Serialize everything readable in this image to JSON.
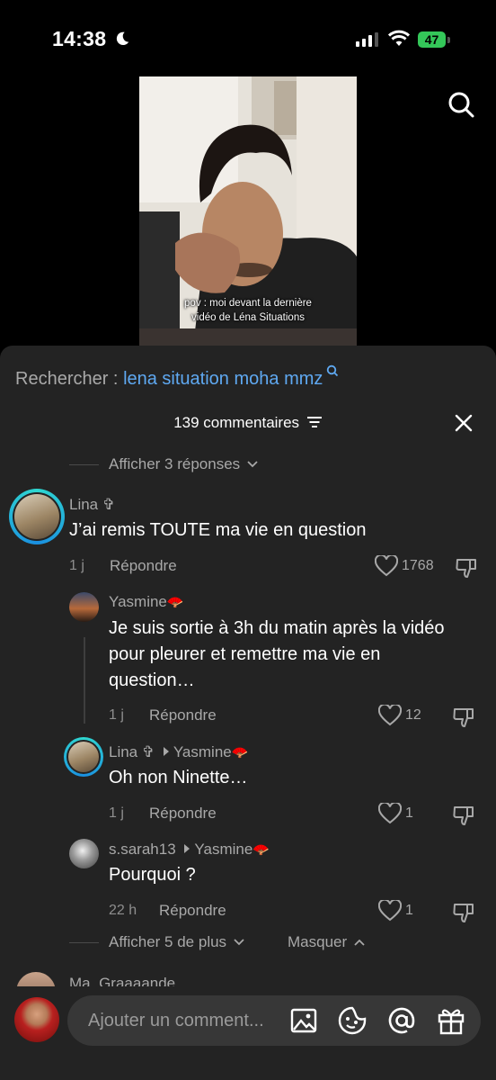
{
  "status": {
    "time": "14:38",
    "battery": "47"
  },
  "video": {
    "caption_line1": "pov : moi devant la dernière",
    "caption_line2": "vidéo de Léna Situations"
  },
  "search": {
    "prefix": "Rechercher :",
    "query": "lena situation moha mmz"
  },
  "comments_header": {
    "count_label": "139 commentaires"
  },
  "thread": {
    "show_prev_replies": "Afficher 3 réponses",
    "main": {
      "name": "Lina ✞",
      "text": "J’ai remis TOUTE ma vie en question",
      "time": "1 j",
      "reply": "Répondre",
      "likes": "1768"
    },
    "replies": [
      {
        "name": "Yasmine",
        "badge": "🪭",
        "text_l1": "Je suis sortie à 3h du matin après la vidéo",
        "text_l2": "pour pleurer et remettre ma vie en",
        "text_l3": "question…",
        "time": "1 j",
        "reply": "Répondre",
        "likes": "12"
      },
      {
        "name": "Lina ✞",
        "to": "Yasmine",
        "text": "Oh non Ninette…",
        "time": "1 j",
        "reply": "Répondre",
        "likes": "1"
      },
      {
        "name": "s.sarah13",
        "to": "Yasmine",
        "text": "Pourquoi ?",
        "time": "22 h",
        "reply": "Répondre",
        "likes": "1"
      }
    ],
    "show_more": "Afficher 5 de plus",
    "hide": "Masquer"
  },
  "next_comment": {
    "name": "Ma_Graaaande"
  },
  "composer": {
    "placeholder": "Ajouter un comment..."
  }
}
